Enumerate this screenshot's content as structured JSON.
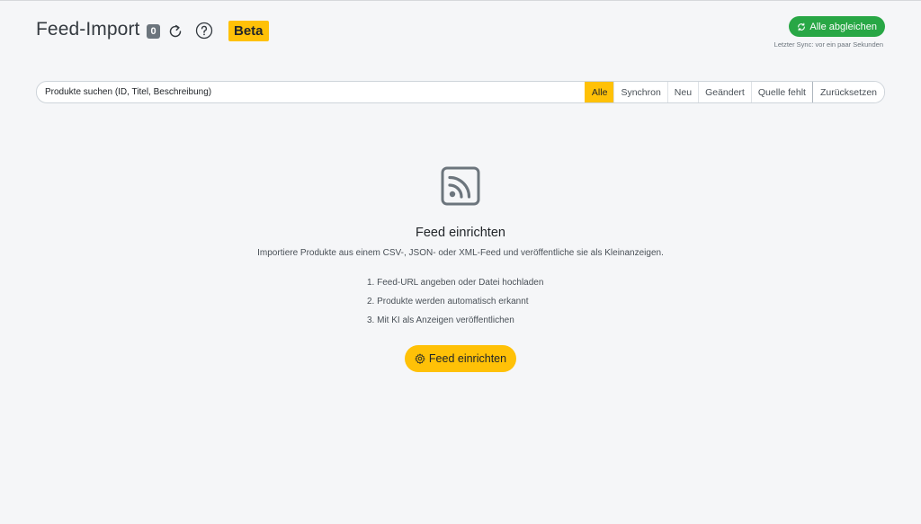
{
  "header": {
    "title": "Feed-Import",
    "count": "0",
    "beta_label": "Beta",
    "sync_all_label": "Alle abgleichen",
    "last_sync": "Letzter Sync: vor ein paar Sekunden"
  },
  "search": {
    "placeholder": "Produkte suchen (ID, Titel, Beschreibung)",
    "value": ""
  },
  "filters": [
    {
      "label": "Alle",
      "active": true
    },
    {
      "label": "Synchron",
      "active": false
    },
    {
      "label": "Neu",
      "active": false
    },
    {
      "label": "Geändert",
      "active": false
    },
    {
      "label": "Quelle fehlt",
      "active": false
    }
  ],
  "reset_label": "Zurücksetzen",
  "empty_state": {
    "icon": "rss-feed-icon",
    "title": "Feed einrichten",
    "description": "Importiere Produkte aus einem CSV-, JSON- oder XML-Feed und veröffentliche sie als Kleinanzeigen.",
    "steps": [
      "1. Feed-URL angeben oder Datei hochladen",
      "2. Produkte werden automatisch erkannt",
      "3. Mit KI als Anzeigen veröffentlichen"
    ],
    "button_label": "Feed einrichten"
  },
  "colors": {
    "accent": "#ffc107",
    "success": "#28a745",
    "badge": "#6c757d",
    "background": "#f5f6f8"
  }
}
